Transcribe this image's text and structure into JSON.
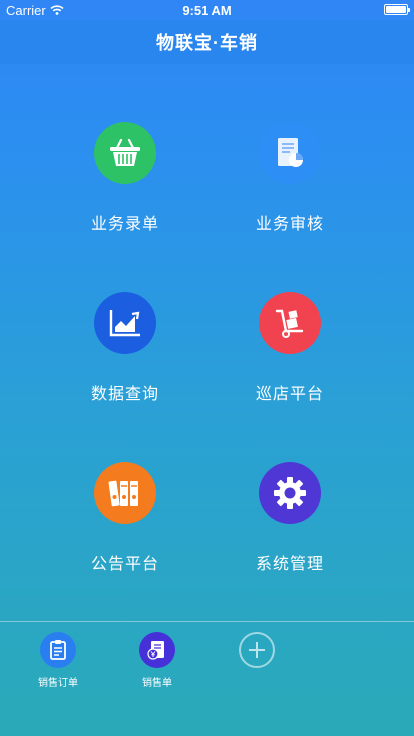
{
  "status_bar": {
    "carrier": "Carrier",
    "time": "9:51 AM",
    "wifi_icon": "wifi-icon",
    "battery_icon": "battery-icon"
  },
  "nav": {
    "title": "物联宝·车销"
  },
  "menu": [
    {
      "label": "业务录单",
      "icon": "basket-icon",
      "color": "#2ec266"
    },
    {
      "label": "业务审核",
      "icon": "document-chart-icon",
      "color": "#2d8ff5"
    },
    {
      "label": "数据查询",
      "icon": "line-chart-icon",
      "color": "#1b5ee0"
    },
    {
      "label": "巡店平台",
      "icon": "hand-truck-icon",
      "color": "#f0434f"
    },
    {
      "label": "公告平台",
      "icon": "binders-icon",
      "color": "#f47b1e"
    },
    {
      "label": "系统管理",
      "icon": "gear-icon",
      "color": "#4f37d6"
    }
  ],
  "tabbar": {
    "items": [
      {
        "label": "销售订单",
        "icon": "clipboard-icon",
        "color": "#2a7ff0"
      },
      {
        "label": "销售单",
        "icon": "yen-document-icon",
        "color": "#4630d8"
      }
    ],
    "add_icon": "plus-icon"
  }
}
